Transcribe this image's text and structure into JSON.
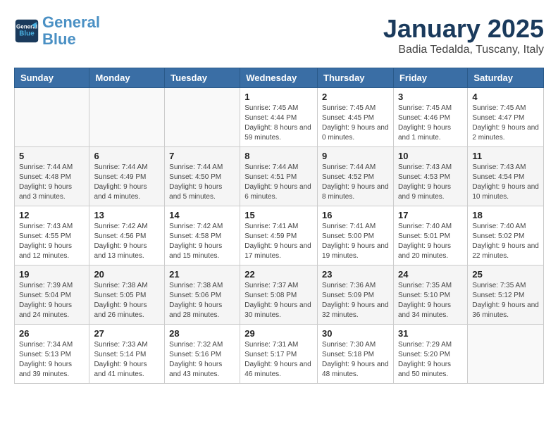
{
  "header": {
    "logo_line1": "General",
    "logo_line2": "Blue",
    "month": "January 2025",
    "location": "Badia Tedalda, Tuscany, Italy"
  },
  "weekdays": [
    "Sunday",
    "Monday",
    "Tuesday",
    "Wednesday",
    "Thursday",
    "Friday",
    "Saturday"
  ],
  "weeks": [
    [
      {
        "day": "",
        "info": ""
      },
      {
        "day": "",
        "info": ""
      },
      {
        "day": "",
        "info": ""
      },
      {
        "day": "1",
        "info": "Sunrise: 7:45 AM\nSunset: 4:44 PM\nDaylight: 8 hours and 59 minutes."
      },
      {
        "day": "2",
        "info": "Sunrise: 7:45 AM\nSunset: 4:45 PM\nDaylight: 9 hours and 0 minutes."
      },
      {
        "day": "3",
        "info": "Sunrise: 7:45 AM\nSunset: 4:46 PM\nDaylight: 9 hours and 1 minute."
      },
      {
        "day": "4",
        "info": "Sunrise: 7:45 AM\nSunset: 4:47 PM\nDaylight: 9 hours and 2 minutes."
      }
    ],
    [
      {
        "day": "5",
        "info": "Sunrise: 7:44 AM\nSunset: 4:48 PM\nDaylight: 9 hours and 3 minutes."
      },
      {
        "day": "6",
        "info": "Sunrise: 7:44 AM\nSunset: 4:49 PM\nDaylight: 9 hours and 4 minutes."
      },
      {
        "day": "7",
        "info": "Sunrise: 7:44 AM\nSunset: 4:50 PM\nDaylight: 9 hours and 5 minutes."
      },
      {
        "day": "8",
        "info": "Sunrise: 7:44 AM\nSunset: 4:51 PM\nDaylight: 9 hours and 6 minutes."
      },
      {
        "day": "9",
        "info": "Sunrise: 7:44 AM\nSunset: 4:52 PM\nDaylight: 9 hours and 8 minutes."
      },
      {
        "day": "10",
        "info": "Sunrise: 7:43 AM\nSunset: 4:53 PM\nDaylight: 9 hours and 9 minutes."
      },
      {
        "day": "11",
        "info": "Sunrise: 7:43 AM\nSunset: 4:54 PM\nDaylight: 9 hours and 10 minutes."
      }
    ],
    [
      {
        "day": "12",
        "info": "Sunrise: 7:43 AM\nSunset: 4:55 PM\nDaylight: 9 hours and 12 minutes."
      },
      {
        "day": "13",
        "info": "Sunrise: 7:42 AM\nSunset: 4:56 PM\nDaylight: 9 hours and 13 minutes."
      },
      {
        "day": "14",
        "info": "Sunrise: 7:42 AM\nSunset: 4:58 PM\nDaylight: 9 hours and 15 minutes."
      },
      {
        "day": "15",
        "info": "Sunrise: 7:41 AM\nSunset: 4:59 PM\nDaylight: 9 hours and 17 minutes."
      },
      {
        "day": "16",
        "info": "Sunrise: 7:41 AM\nSunset: 5:00 PM\nDaylight: 9 hours and 19 minutes."
      },
      {
        "day": "17",
        "info": "Sunrise: 7:40 AM\nSunset: 5:01 PM\nDaylight: 9 hours and 20 minutes."
      },
      {
        "day": "18",
        "info": "Sunrise: 7:40 AM\nSunset: 5:02 PM\nDaylight: 9 hours and 22 minutes."
      }
    ],
    [
      {
        "day": "19",
        "info": "Sunrise: 7:39 AM\nSunset: 5:04 PM\nDaylight: 9 hours and 24 minutes."
      },
      {
        "day": "20",
        "info": "Sunrise: 7:38 AM\nSunset: 5:05 PM\nDaylight: 9 hours and 26 minutes."
      },
      {
        "day": "21",
        "info": "Sunrise: 7:38 AM\nSunset: 5:06 PM\nDaylight: 9 hours and 28 minutes."
      },
      {
        "day": "22",
        "info": "Sunrise: 7:37 AM\nSunset: 5:08 PM\nDaylight: 9 hours and 30 minutes."
      },
      {
        "day": "23",
        "info": "Sunrise: 7:36 AM\nSunset: 5:09 PM\nDaylight: 9 hours and 32 minutes."
      },
      {
        "day": "24",
        "info": "Sunrise: 7:35 AM\nSunset: 5:10 PM\nDaylight: 9 hours and 34 minutes."
      },
      {
        "day": "25",
        "info": "Sunrise: 7:35 AM\nSunset: 5:12 PM\nDaylight: 9 hours and 36 minutes."
      }
    ],
    [
      {
        "day": "26",
        "info": "Sunrise: 7:34 AM\nSunset: 5:13 PM\nDaylight: 9 hours and 39 minutes."
      },
      {
        "day": "27",
        "info": "Sunrise: 7:33 AM\nSunset: 5:14 PM\nDaylight: 9 hours and 41 minutes."
      },
      {
        "day": "28",
        "info": "Sunrise: 7:32 AM\nSunset: 5:16 PM\nDaylight: 9 hours and 43 minutes."
      },
      {
        "day": "29",
        "info": "Sunrise: 7:31 AM\nSunset: 5:17 PM\nDaylight: 9 hours and 46 minutes."
      },
      {
        "day": "30",
        "info": "Sunrise: 7:30 AM\nSunset: 5:18 PM\nDaylight: 9 hours and 48 minutes."
      },
      {
        "day": "31",
        "info": "Sunrise: 7:29 AM\nSunset: 5:20 PM\nDaylight: 9 hours and 50 minutes."
      },
      {
        "day": "",
        "info": ""
      }
    ]
  ]
}
